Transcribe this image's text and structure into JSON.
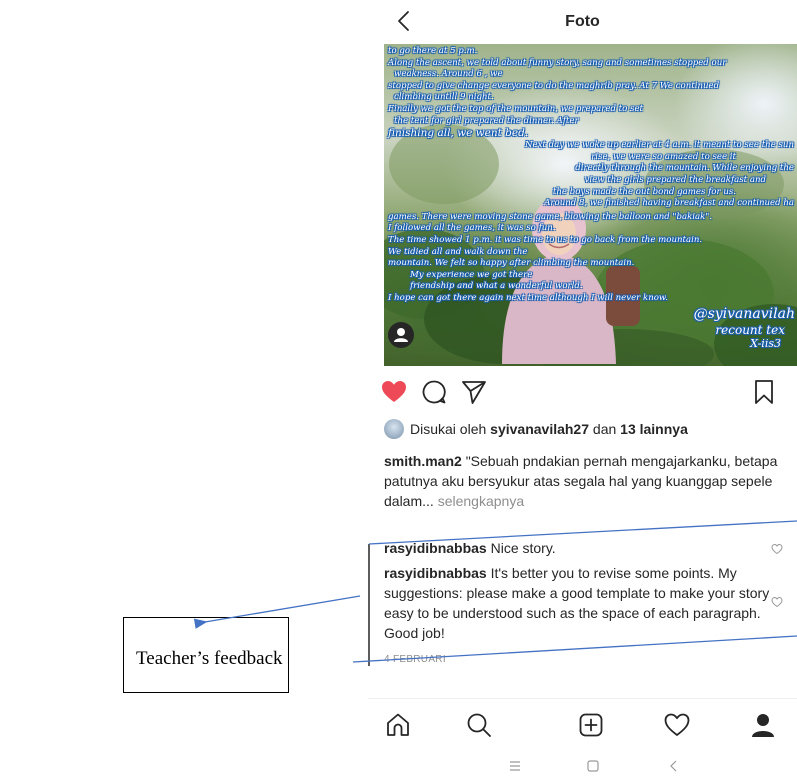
{
  "header": {
    "title": "Foto",
    "back_icon": "chevron-left-icon"
  },
  "post_image": {
    "caption_lines": [
      "to go there at 5 p.m.",
      "Along the ascent, we told about funny story, sang and sometimes stopped our",
      "weakness. Around 6 , we",
      "stopped to give change everyone to do the maghrib pray. At 7 We continued",
      "climbing untill 9 night.",
      "Finally we got the top of the mountain, we prepared to set",
      "the tent for girl prepared the dinner. After",
      "finishing all, we went bed.",
      "Next day we woke up earlier at 4 a.m. it meant to see the sun",
      "rise, we were so amazed to see it",
      "directly through the mountain. While enjoying the",
      "view the girls prepared the breakfast and",
      "the boys made the out bond games for us.",
      "Around 8, we finished having breakfast and continued ha",
      "games. There were moving stone game, blowing the balloon and \"bakiak\".",
      "I followed all the games, it was so fun.",
      "The time showed 1 p.m. it was time to us to go back from the mountain.",
      "We tidied all and walk down the",
      "mountain. We felt so happy after climbing the mountain.",
      "My experience we got there",
      "friendship and what a wonderful world.",
      "I hope can got there again next time although I will never know."
    ],
    "watermark": [
      "@syivanavilah",
      "recount tex",
      "X-iis3"
    ],
    "user_tag_icon": "person-icon"
  },
  "actions": {
    "like_icon": "heart-filled-icon",
    "comment_icon": "comment-icon",
    "share_icon": "send-icon",
    "save_icon": "bookmark-icon",
    "like_color": "#ed4956"
  },
  "likes": {
    "prefix": "Disukai oleh",
    "user": "syivanavilah27",
    "connector": "dan",
    "others": "13 lainnya"
  },
  "caption": {
    "user": "smith.man2",
    "text": "\"Sebuah pndakian pernah mengajarkanku, betapa patutnya aku bersyukur atas segala hal yang kuanggap sepele dalam...",
    "more": "selengkapnya"
  },
  "comments": [
    {
      "user": "rasyidibnabbas",
      "text": "Nice story."
    },
    {
      "user": "rasyidibnabbas",
      "text": "It's better you to revise some points. My suggestions: please make a good template to make your story easy to be understood such as the space of each paragraph. Good job!"
    }
  ],
  "date": "4 FEBRUARI",
  "bottom_nav": [
    "home-icon",
    "search-icon",
    "add-post-icon",
    "activity-heart-icon",
    "profile-icon"
  ],
  "system_nav": [
    "menu-icon",
    "home-square-icon",
    "back-icon"
  ],
  "annotation": {
    "label": "Teacher’s feedback",
    "line_color": "#4472c4"
  }
}
